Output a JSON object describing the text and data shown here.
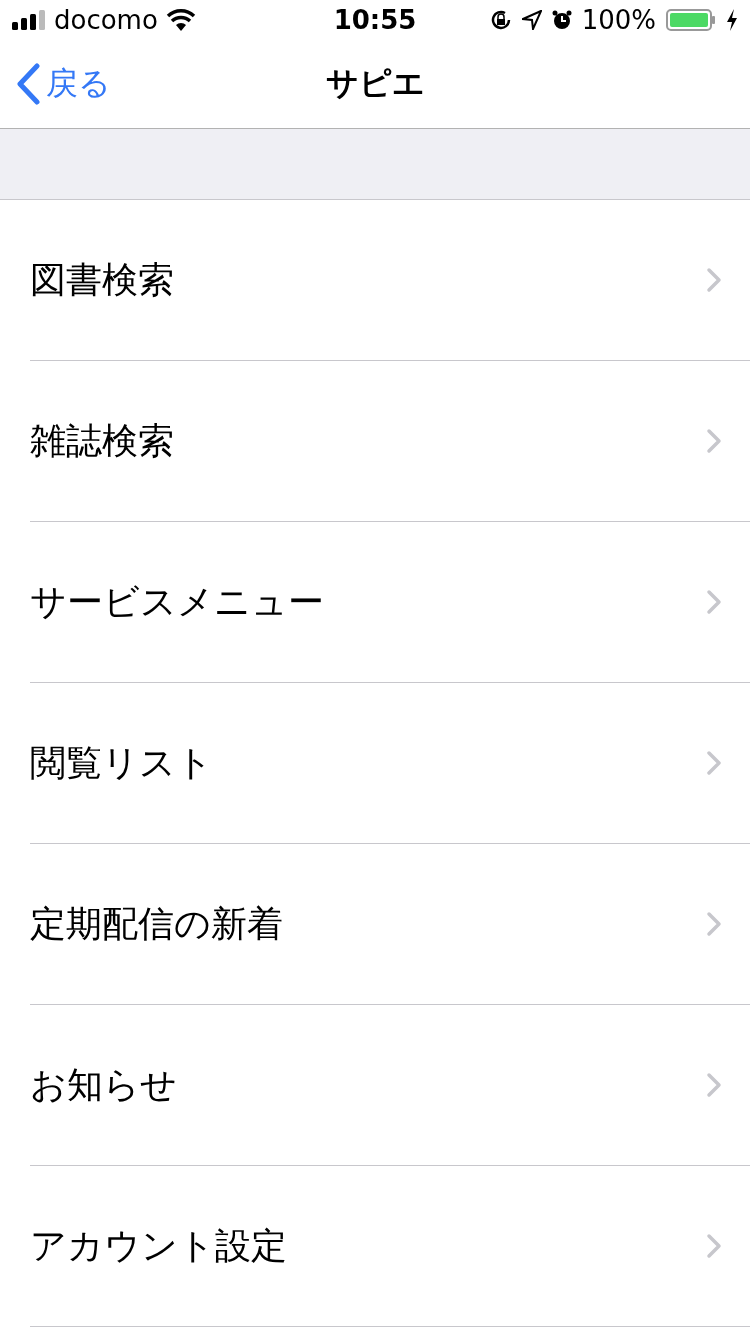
{
  "status_bar": {
    "carrier": "docomo",
    "time": "10:55",
    "battery": "100%"
  },
  "nav": {
    "back": "戻る",
    "title": "サピエ"
  },
  "menu": [
    {
      "label": "図書検索"
    },
    {
      "label": "雑誌検索"
    },
    {
      "label": "サービスメニュー"
    },
    {
      "label": "閲覧リスト"
    },
    {
      "label": "定期配信の新着"
    },
    {
      "label": "お知らせ"
    },
    {
      "label": "アカウント設定"
    }
  ]
}
